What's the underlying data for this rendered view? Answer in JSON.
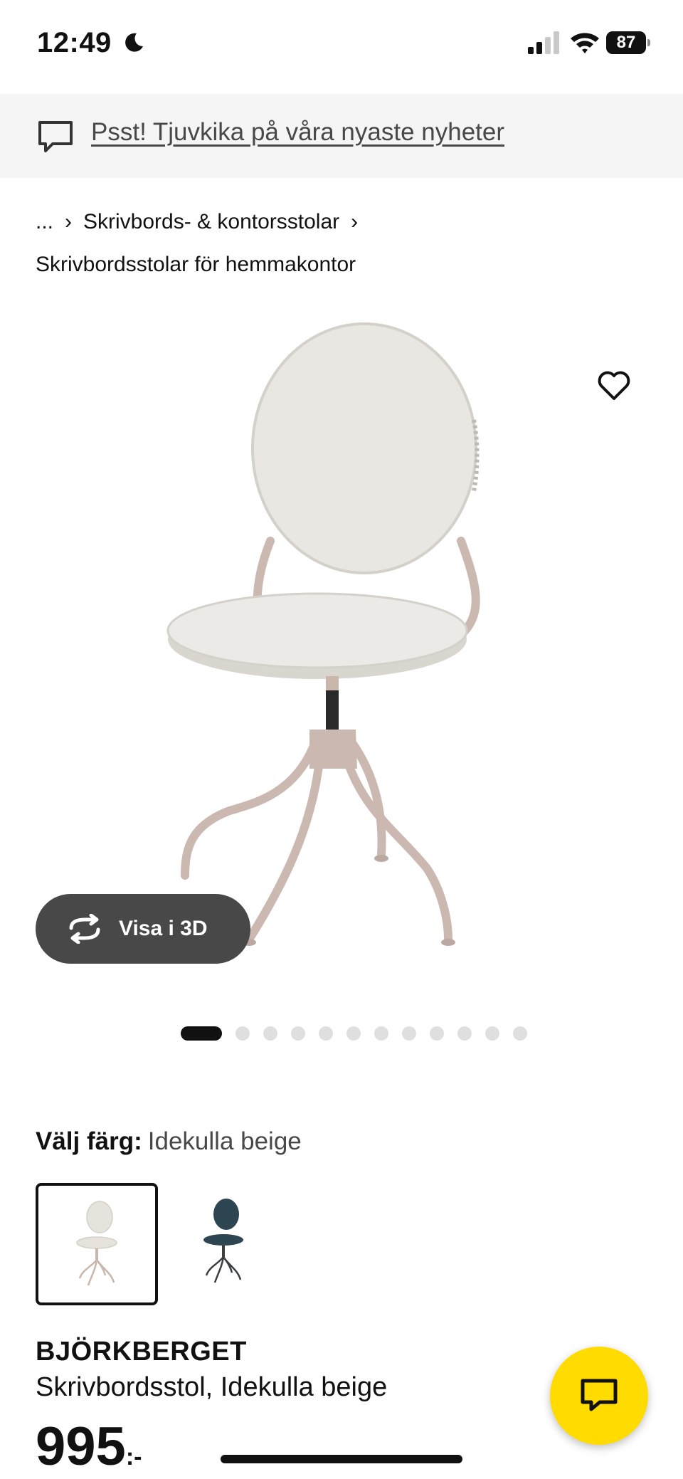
{
  "status_bar": {
    "time": "12:49",
    "battery": "87"
  },
  "promo": {
    "text": "Psst! Tjuvkika på våra nyaste nyheter"
  },
  "breadcrumb": {
    "items": [
      "...",
      "Skrivbords- & kontorsstolar",
      "Skrivbordsstolar för hemmakontor"
    ]
  },
  "gallery": {
    "view_3d_label": "Visa i 3D",
    "image_count": 12,
    "active_index": 0
  },
  "color_select": {
    "label": "Välj färg:",
    "selected": "Idekulla beige",
    "options": [
      {
        "name": "Idekulla beige",
        "color": "#e6e2dc",
        "frame": "#c9b6ad"
      },
      {
        "name": "navy",
        "color": "#2e4552",
        "frame": "#3a3f44"
      }
    ]
  },
  "product": {
    "name": "BJÖRKBERGET",
    "description": "Skrivbordsstol, Idekulla beige",
    "price": "995",
    "price_suffix": ":-"
  },
  "colors": {
    "banner_bg": "#f5f5f5",
    "fab": "#ffdb00",
    "button_dark": "#484848"
  }
}
